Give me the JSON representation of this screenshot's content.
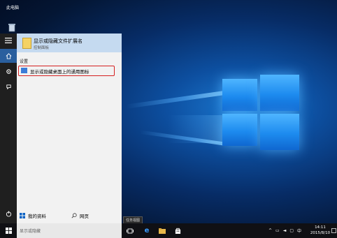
{
  "desktop": {
    "this_pc_label": "此电脑",
    "recycle_bin_icon": "recycle-bin-icon"
  },
  "start_panel": {
    "best_match": {
      "title": "显示或隐藏文件扩展名",
      "subtitle": "控制面板"
    },
    "settings_header": "设置",
    "setting_item": "显示或隐藏桌面上的通用图标",
    "my_stuff_label": "我的资料",
    "web_label": "网页"
  },
  "taskbar": {
    "search_text": "显示或隐藏",
    "task_view_tooltip": "任务视图",
    "ime_label": "中",
    "time": "14:11",
    "date": "2015/8/10"
  },
  "colors": {
    "taskbar": "#101014",
    "panel": "#f2f2f2",
    "highlight": "#c5daf0",
    "accent": "#2a5f9e",
    "red_box": "#d52020"
  }
}
